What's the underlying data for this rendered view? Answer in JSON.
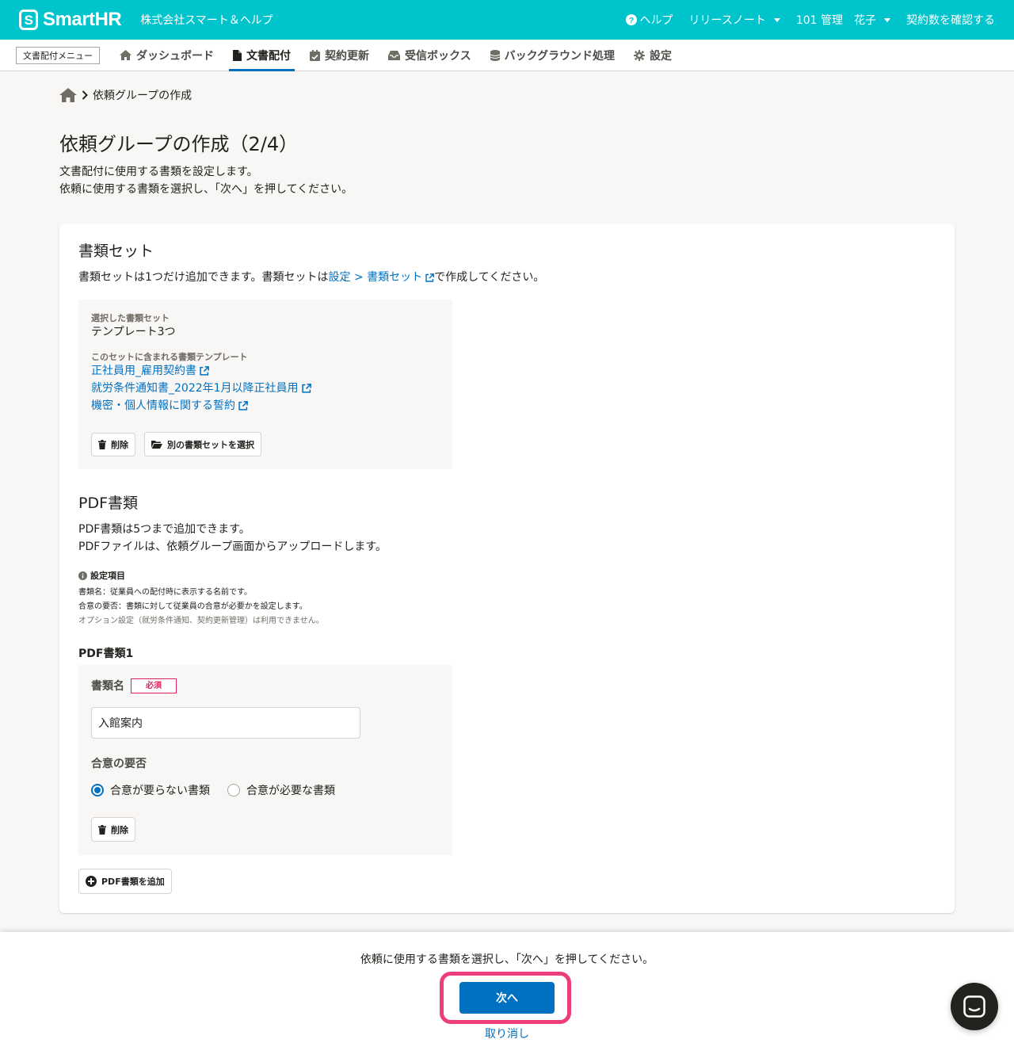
{
  "header": {
    "logo_text": "SmartHR",
    "logo_mark": "S",
    "company": "株式会社スマート＆ヘルプ",
    "help": "ヘルプ",
    "release_notes": "リリースノート",
    "user": "101 管理　花子",
    "contract": "契約数を確認する"
  },
  "nav": {
    "menu_label": "文書配付メニュー",
    "tabs": [
      {
        "label": "ダッシュボード",
        "icon": "home-icon"
      },
      {
        "label": "文書配付",
        "icon": "document-icon",
        "active": true
      },
      {
        "label": "契約更新",
        "icon": "calendar-check-icon"
      },
      {
        "label": "受信ボックス",
        "icon": "inbox-icon"
      },
      {
        "label": "バックグラウンド処理",
        "icon": "database-icon"
      },
      {
        "label": "設定",
        "icon": "gear-icon"
      }
    ]
  },
  "breadcrumb": {
    "current": "依頼グループの作成"
  },
  "page": {
    "title": "依頼グループの作成（2/4）",
    "desc_line1": "文書配付に使用する書類を設定します。",
    "desc_line2": "依頼に使用する書類を選択し、「次へ」を押してください。"
  },
  "document_set": {
    "title": "書類セット",
    "desc_prefix": "書類セットは1つだけ追加できます。書類セットは ",
    "desc_link": "設定 > 書類セット",
    "desc_suffix": " で作成してください。",
    "selected_label": "選択した書類セット",
    "selected_value": "テンプレート3つ",
    "templates_label": "このセットに含まれる書類テンプレート",
    "templates": [
      "正社員用_雇用契約書",
      "就労条件通知書_2022年1月以降正社員用",
      "機密・個人情報に関する誓約"
    ],
    "delete_button": "削除",
    "select_other_button": "別の書類セットを選択"
  },
  "pdf": {
    "title": "PDF書類",
    "desc_line1": "PDF書類は5つまで追加できます。",
    "desc_line2": "PDFファイルは、依頼グループ画面からアップロードします。",
    "info_title": "設定項目",
    "info_line1": "書類名：従業員への配付時に表示する名前です。",
    "info_line2": "合意の要否：書類に対して従業員の合意が必要かを設定します。",
    "info_line3": "オプション設定（就労条件通知、契約更新管理）は利用できません。",
    "item_title": "PDF書類1",
    "name_label": "書類名",
    "required_badge": "必須",
    "name_value": "入館案内",
    "consent_label": "合意の要否",
    "consent_options": [
      "合意が要らない書類",
      "合意が必要な書類"
    ],
    "consent_selected": "合意が要らない書類",
    "delete_button": "削除",
    "add_button": "PDF書類を追加"
  },
  "footer": {
    "message": "依頼に使用する書類を選択し、「次へ」を押してください。",
    "next_button": "次へ",
    "cancel_link": "取り消し"
  },
  "colors": {
    "brand": "#00c4cc",
    "link": "#0071c1",
    "primary_button": "#0071c1",
    "required": "#e01e5a",
    "highlight": "#ee3d7c"
  }
}
